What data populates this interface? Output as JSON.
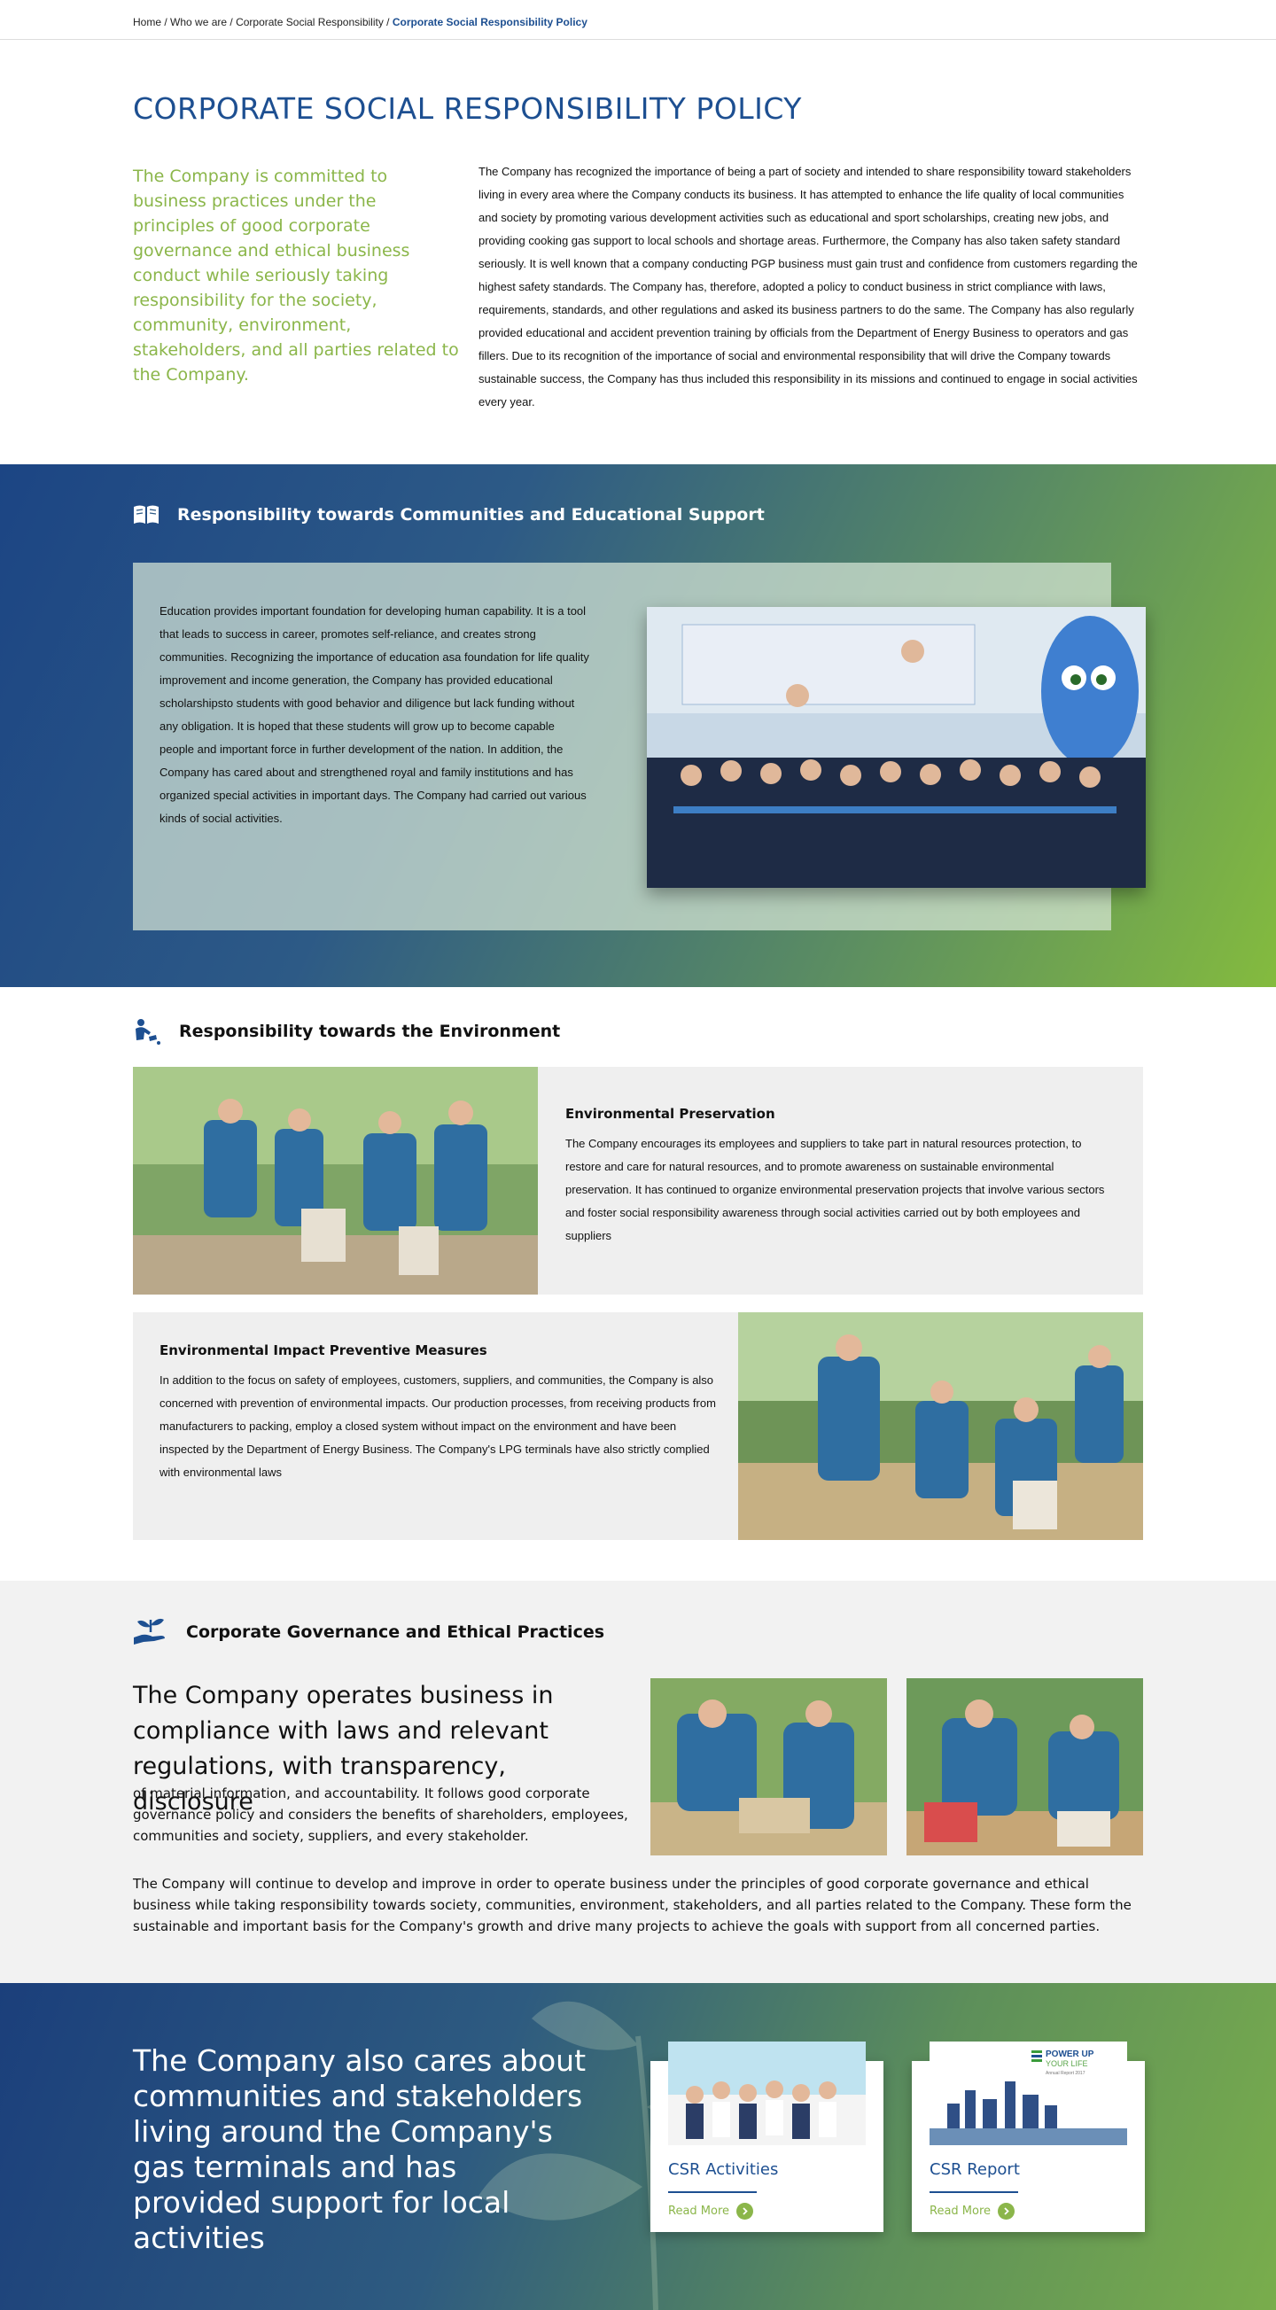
{
  "breadcrumb": {
    "items": [
      "Home",
      "Who we are",
      "Corporate Social Responsibility"
    ],
    "separator": " / ",
    "current": "Corporate Social Responsibility Policy"
  },
  "intro": {
    "title": "CORPORATE SOCIAL RESPONSIBILITY POLICY",
    "lead": "The Company is committed to business practices under the principles of good corporate governance and ethical business conduct while seriously taking responsibility for the society, community, environment, stakeholders, and all parties related to the Company.",
    "body": "The Company has recognized the importance of being a part of society and intended to share responsibility toward stakeholders living in every area where the Company conducts its business. It has attempted to enhance the life quality of local communities and society by promoting various development activities such as educational and sport scholarships, creating new jobs, and providing cooking gas support to local schools and shortage areas. Furthermore, the Company has also taken safety standard seriously. It is well known that a company conducting PGP business must gain trust and confidence from customers regarding the highest safety standards. The Company has, therefore, adopted a policy to conduct business in strict compliance with laws, requirements, standards, and other regulations and asked its business partners to do the same. The Company has also regularly provided educational and accident prevention training by officials from the Department of Energy Business to operators and gas fillers. Due to its recognition of the importance of social and environmental responsibility that will drive the Company towards sustainable success, the Company has thus included this responsibility in its missions and continued to engage in social activities every year."
  },
  "communities": {
    "icon": "open-book-icon",
    "heading": "Responsibility towards Communities and Educational Support",
    "text": "Education provides important foundation for developing human capability. It is a tool that leads to success in career, promotes self-reliance, and creates strong communities. Recognizing the importance of education asa foundation for life quality improvement and income generation, the Company has provided educational scholarshipsto students with good behavior and diligence but lack funding without any obligation. It is hoped that these students will grow up to become capable people and important force in further development of the nation. In addition, the Company has cared about and strengthened royal and family institutions and has organized special activities in important days. The Company had carried out various kinds of social activities.",
    "photo_alt": "students-group-photo"
  },
  "environment": {
    "icon": "watering-person-icon",
    "heading": "Responsibility towards the Environment",
    "items": [
      {
        "title": "Environmental Preservation",
        "text": "The Company encourages its employees and suppliers to take part in natural resources protection, to restore and care for natural resources, and to promote awareness on sustainable environmental preservation. It has continued to organize environmental preservation projects that involve various sectors and foster social responsibility awareness through social activities carried out by both employees and suppliers"
      },
      {
        "title": "Environmental Impact Preventive Measures",
        "text": "In addition to the focus on safety of employees, customers, suppliers, and communities, the Company is also concerned with prevention of environmental impacts. Our production processes, from receiving products from manufacturers to packing, employ a closed system without impact on the environment and have been inspected by the Department of Energy Business. The Company's LPG terminals have also strictly complied with environmental laws"
      }
    ]
  },
  "governance": {
    "icon": "hand-seedling-icon",
    "heading": "Corporate Governance and Ethical Practices",
    "big": "The Company operates business in compliance with laws and relevant regulations, with transparency, disclosure",
    "small": "of material information, and accountability. It follows good corporate governance policy and considers the benefits of shareholders, employees, communities and society, suppliers, and every stakeholder.",
    "paragraph": "The Company will continue to develop and improve in order to operate business under the principles of good corporate governance and ethical business while taking responsibility towards society, communities, environment, stakeholders, and all parties related to the Company. These form the sustainable and important basis for the Company's growth and drive many projects to achieve the goals with support from all concerned parties."
  },
  "footer": {
    "claim": "The Company also cares about communities and stakeholders living around the Company's gas terminals and has provided support for local activities",
    "cards": [
      {
        "title": "CSR Activities",
        "more": "Read More"
      },
      {
        "title": "CSR Report",
        "more": "Read More",
        "thumb_text": [
          "POWER UP",
          "YOUR LIFE",
          "Annual Report 2017"
        ]
      }
    ]
  },
  "colors": {
    "brand_blue": "#1d4f91",
    "brand_green": "#8bb64a"
  }
}
